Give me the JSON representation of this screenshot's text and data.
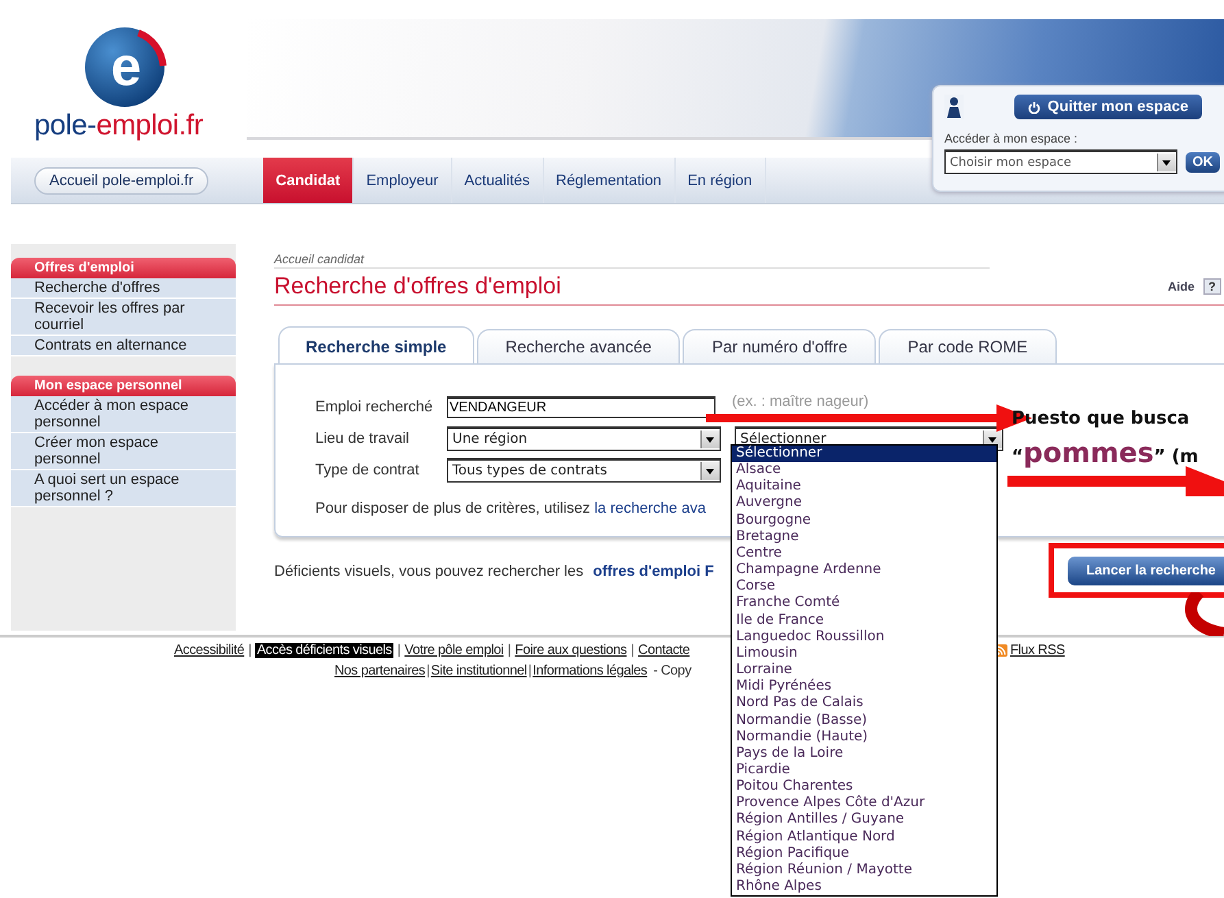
{
  "logo": {
    "letter": "e",
    "parts": [
      {
        "text": "pole-",
        "kind": "primary"
      },
      {
        "text": "emploi.fr",
        "kind": "accent"
      }
    ]
  },
  "account": {
    "quit_button": "Quitter mon espace",
    "space_label": "Accéder à mon espace :",
    "space_select": "Choisir mon espace",
    "ok_button": "OK"
  },
  "nav": {
    "home": "Accueil pole-emploi.fr",
    "tabs": [
      {
        "label": "Candidat",
        "selected": true
      },
      {
        "label": "Employeur",
        "selected": false
      },
      {
        "label": "Actualités",
        "selected": false
      },
      {
        "label": "Réglementation",
        "selected": false
      },
      {
        "label": "En région",
        "selected": false
      }
    ]
  },
  "sidebar": {
    "sections": [
      {
        "title": "Offres d'emploi",
        "items": [
          "Recherche d'offres",
          "Recevoir les offres par courriel",
          "Contrats en alternance"
        ]
      },
      {
        "title": "Mon espace personnel",
        "items": [
          "Accéder à mon espace personnel",
          "Créer mon espace personnel",
          "A quoi sert un espace personnel ?"
        ]
      }
    ]
  },
  "breadcrumb": "Accueil candidat",
  "title": "Recherche d'offres d'emploi",
  "help": "Aide",
  "help_icon": "?",
  "search_tabs": [
    {
      "label": "Recherche simple",
      "selected": true
    },
    {
      "label": "Recherche avancée",
      "selected": false
    },
    {
      "label": "Par numéro d'offre",
      "selected": false
    },
    {
      "label": "Par code ROME",
      "selected": false
    }
  ],
  "form": {
    "fields": [
      {
        "kind": "text",
        "label": "Emploi recherché",
        "value": "VENDANGEUR",
        "example": "(ex. : maître nageur)"
      },
      {
        "kind": "select",
        "label": "Lieu de travail",
        "value": "Une région",
        "second_select": "Sélectionner"
      },
      {
        "kind": "select",
        "label": "Type de contrat",
        "value": "Tous types de contrats"
      }
    ],
    "note": "Pour disposer de plus de critères, utilisez",
    "note_link": "la recherche ava"
  },
  "visually_impaired": {
    "text": "Déficients visuels, vous pouvez rechercher les",
    "link": "offres d'emploi F"
  },
  "search_button": "Lancer la recherche",
  "footer": {
    "row1": [
      {
        "label": "Accessibilité",
        "kind": "link"
      },
      {
        "label": "Accès déficients visuels",
        "kind": "highlight"
      },
      {
        "label": "Votre pôle emploi",
        "kind": "link"
      },
      {
        "label": "Foire aux questions",
        "kind": "link"
      },
      {
        "label": "Contacte",
        "kind": "link"
      }
    ],
    "rss": "Flux RSS",
    "row2": [
      "Nos partenaires",
      "Site institutionnel",
      "Informations légales"
    ],
    "row2_suffix": "- Copy",
    "separator": "|"
  },
  "dropdown": {
    "options": [
      {
        "label": "Sélectionner",
        "selected": true
      },
      {
        "label": "Alsace",
        "selected": false
      },
      {
        "label": "Aquitaine",
        "selected": false
      },
      {
        "label": "Auvergne",
        "selected": false
      },
      {
        "label": "Bourgogne",
        "selected": false
      },
      {
        "label": "Bretagne",
        "selected": false
      },
      {
        "label": "Centre",
        "selected": false
      },
      {
        "label": "Champagne Ardenne",
        "selected": false
      },
      {
        "label": "Corse",
        "selected": false
      },
      {
        "label": "Franche Comté",
        "selected": false
      },
      {
        "label": "Ile de France",
        "selected": false
      },
      {
        "label": "Languedoc Roussillon",
        "selected": false
      },
      {
        "label": "Limousin",
        "selected": false
      },
      {
        "label": "Lorraine",
        "selected": false
      },
      {
        "label": "Midi Pyrénées",
        "selected": false
      },
      {
        "label": "Nord Pas de Calais",
        "selected": false
      },
      {
        "label": "Normandie (Basse)",
        "selected": false
      },
      {
        "label": "Normandie (Haute)",
        "selected": false
      },
      {
        "label": "Pays de la Loire",
        "selected": false
      },
      {
        "label": "Picardie",
        "selected": false
      },
      {
        "label": "Poitou Charentes",
        "selected": false
      },
      {
        "label": "Provence Alpes Côte d'Azur",
        "selected": false
      },
      {
        "label": "Région Antilles / Guyane",
        "selected": false
      },
      {
        "label": "Région Atlantique Nord",
        "selected": false
      },
      {
        "label": "Région Pacifique",
        "selected": false
      },
      {
        "label": "Région Réunion / Mayotte",
        "selected": false
      },
      {
        "label": "Rhône Alpes",
        "selected": false
      }
    ]
  },
  "annotation": {
    "line1": "Puesto que busca",
    "line2": [
      {
        "text": "“",
        "kind": "plain"
      },
      {
        "text": "pommes",
        "kind": "keyword"
      },
      {
        "text": "” (m",
        "kind": "plain"
      }
    ]
  }
}
